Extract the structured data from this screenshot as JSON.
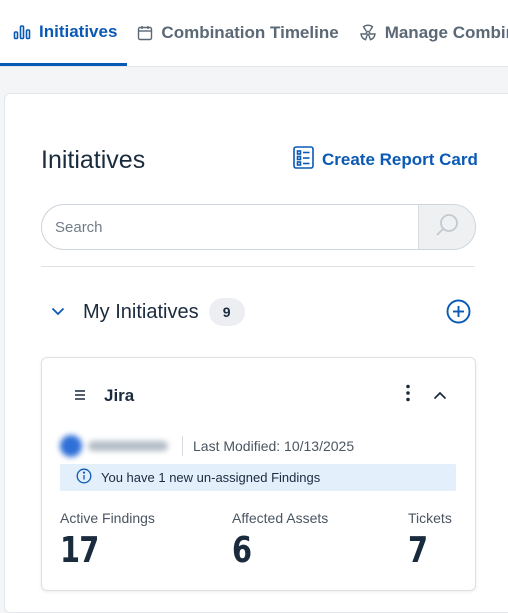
{
  "tabs": [
    {
      "label": "Initiatives",
      "icon": "bar-chart-icon",
      "active": true
    },
    {
      "label": "Combination Timeline",
      "icon": "calendar-icon",
      "active": false
    },
    {
      "label": "Manage Combinations",
      "icon": "radiation-icon",
      "active": false
    }
  ],
  "panel": {
    "title": "Initiatives",
    "report_button": "Create Report Card",
    "search_placeholder": "Search"
  },
  "section": {
    "title": "My Initiatives",
    "count": "9"
  },
  "card": {
    "title": "Jira",
    "last_modified": "Last Modified: 10/13/2025",
    "notice": "You have 1 new un-assigned Findings",
    "stats": [
      {
        "label": "Active Findings",
        "value": "17"
      },
      {
        "label": "Affected Assets",
        "value": "6"
      },
      {
        "label": "Tickets",
        "value": "7"
      }
    ]
  },
  "colors": {
    "accent": "#0a5ab5",
    "text": "#1b2b3e",
    "notice_bg": "#e3effb"
  }
}
